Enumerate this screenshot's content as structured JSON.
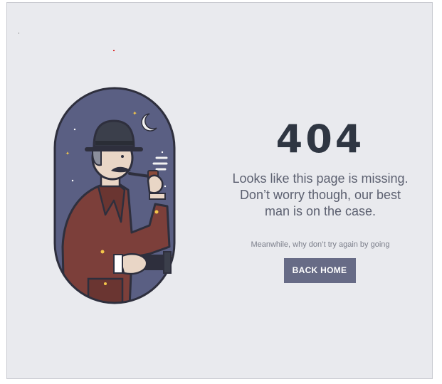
{
  "error": {
    "code": "404",
    "message_lines": [
      "Looks like this page is missing.",
      "Don’t worry though, our best",
      "man is on the case."
    ],
    "sub_text": "Meanwhile, why don’t try again by going",
    "button_label": "BACK HOME"
  },
  "colors": {
    "background": "#e9eaee",
    "heading": "#2f3642",
    "text": "#5c6070",
    "button": "#676b86",
    "illustration_sky": "#5a5f83",
    "coat": "#7c3f3a"
  },
  "icons": [
    "detective-illustration",
    "moon-icon",
    "star-icon"
  ]
}
